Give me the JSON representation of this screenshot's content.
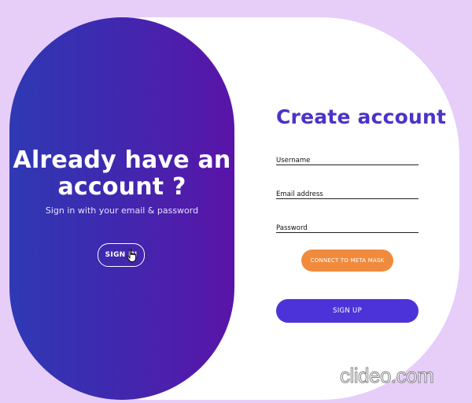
{
  "overlay": {
    "title_line1": "Already have an",
    "title_line2": "account ?",
    "subtitle": "Sign in with your email & password",
    "signin_label": "SIGN IN"
  },
  "form": {
    "title": "Create account",
    "username_label": "Username",
    "email_label": "Email address",
    "password_label": "Password",
    "connect_label": "CONNECT TO META MASK",
    "signup_label": "SIGN UP"
  },
  "watermark": "clideo.com",
  "colors": {
    "background": "#e6cef9",
    "gradient_start": "#2f39b4",
    "gradient_end": "#5a14a8",
    "accent": "#4b33c8",
    "connect_button": "#f08b3d"
  },
  "icons": [
    "hand-pointer-cursor-icon"
  ]
}
